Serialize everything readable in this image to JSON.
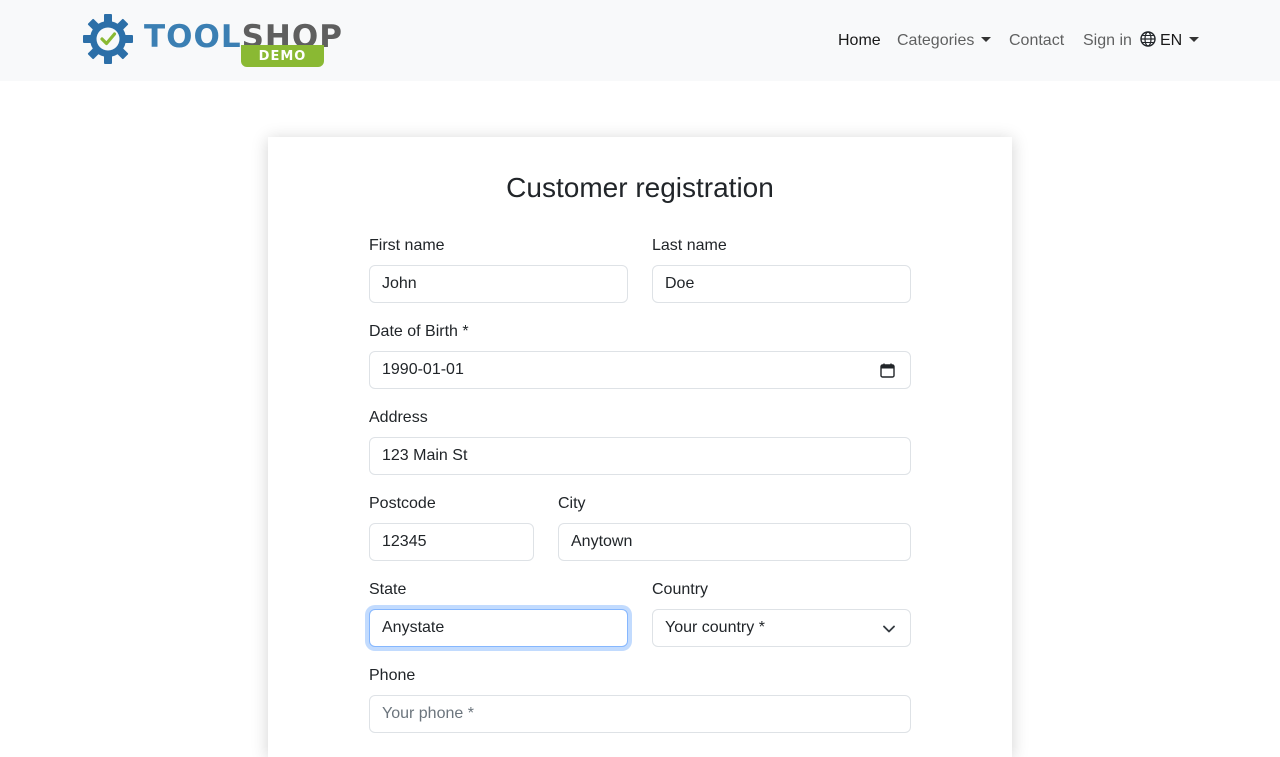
{
  "header": {
    "logo": {
      "word_primary": "TOOL",
      "word_secondary": "SHOP",
      "badge": "DEMO"
    },
    "nav": {
      "home": "Home",
      "categories": "Categories",
      "contact": "Contact",
      "sign_in": "Sign in",
      "language": "EN"
    }
  },
  "form": {
    "title": "Customer registration",
    "first_name": {
      "label": "First name",
      "value": "John"
    },
    "last_name": {
      "label": "Last name",
      "value": "Doe"
    },
    "dob": {
      "label": "Date of Birth *",
      "value": "1990-01-01"
    },
    "address": {
      "label": "Address",
      "value": "123 Main St"
    },
    "postcode": {
      "label": "Postcode",
      "value": "12345"
    },
    "city": {
      "label": "City",
      "value": "Anytown"
    },
    "state": {
      "label": "State",
      "value": "Anystate"
    },
    "country": {
      "label": "Country",
      "selected": "Your country *"
    },
    "phone": {
      "label": "Phone",
      "placeholder": "Your phone *"
    }
  },
  "colors": {
    "brand_blue": "#3b7fb3",
    "brand_green": "#8ab933",
    "focus_ring": "#86b7fe"
  },
  "icons": [
    "gear-check-icon",
    "globe-icon",
    "calendar-icon",
    "chevron-down-icon",
    "caret-down-icon"
  ]
}
